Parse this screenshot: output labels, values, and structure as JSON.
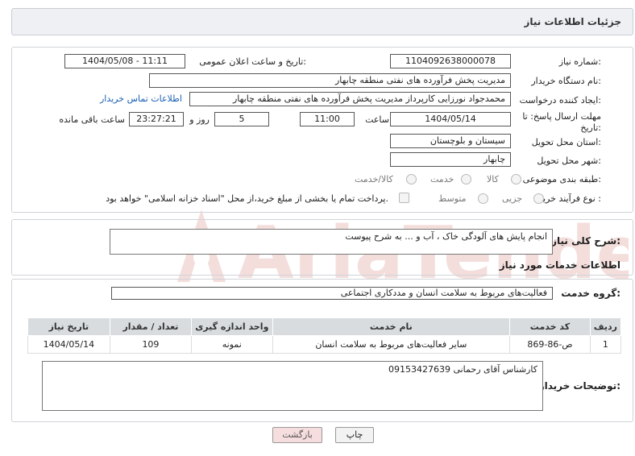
{
  "header": {
    "title": "جزئیات اطلاعات نیاز"
  },
  "form": {
    "need_number_label": "شماره نیاز:",
    "need_number": "1104092638000078",
    "announce_label": "تاریخ و ساعت اعلان عمومی:",
    "announce_value": "1404/05/08 - 11:11",
    "buyer_label": "نام دستگاه خریدار:",
    "buyer_value": "مدیریت پخش فرآورده های نفتی منطقه چابهار",
    "creator_label": "ایجاد کننده درخواست:",
    "creator_value": "محمدجواد نورزایی کارپرداز مدیریت پخش فرآورده های نفتی منطقه چابهار",
    "contact_link": "اطلاعات تماس خریدار",
    "deadline_label_1": "مهلت ارسال پاسخ: تا",
    "deadline_label_2": "تاریخ:",
    "deadline_date": "1404/05/14",
    "time_label": "ساعت",
    "deadline_time": "11:00",
    "days_value": "5",
    "days_label": "روز و",
    "remaining_time": "23:27:21",
    "remaining_label": "ساعت باقی مانده",
    "province_label": "استان محل تحویل:",
    "province_value": "سیستان و بلوچستان",
    "city_label": "شهر محل تحویل:",
    "city_value": "چابهار",
    "category_label": "طبقه بندی موضوعی:",
    "category_options": [
      "کالا",
      "خدمت",
      "کالا/خدمت"
    ],
    "process_label": "نوع فرآیند خرید :",
    "process_options": [
      "جزیی",
      "متوسط"
    ],
    "payment_note": "پرداخت تمام یا بخشی از مبلغ خرید،از محل \"اسناد خزانه اسلامی\" خواهد بود."
  },
  "summary": {
    "label": "شرح کلی نیاز:",
    "value": "انجام پایش های آلودگی خاک ، آب  و ... به شرح پیوست"
  },
  "services": {
    "section_title": "اطلاعات خدمات مورد نیاز",
    "group_label": "گروه خدمت:",
    "group_value": "فعالیت‌های مربوط به سلامت انسان و مددکاری اجتماعی",
    "columns": [
      "ردیف",
      "کد خدمت",
      "نام خدمت",
      "واحد اندازه گیری",
      "تعداد / مقدار",
      "تاریخ نیاز"
    ],
    "rows": [
      [
        "1",
        "ص-86-869",
        "سایر فعالیت‌های مربوط به سلامت انسان",
        "نمونه",
        "109",
        "1404/05/14"
      ]
    ]
  },
  "notes": {
    "label": "توضیحات خریدار:",
    "value": "کارشناس  آقای رحمانی 09153427639"
  },
  "buttons": {
    "print": "چاپ",
    "back": "بازگشت"
  },
  "watermark": {
    "text": "AriaTender.neT"
  },
  "colors": {
    "link": "#1a5fb4",
    "watermark": "#c0392b",
    "back_button_bg": "#f7dede"
  }
}
